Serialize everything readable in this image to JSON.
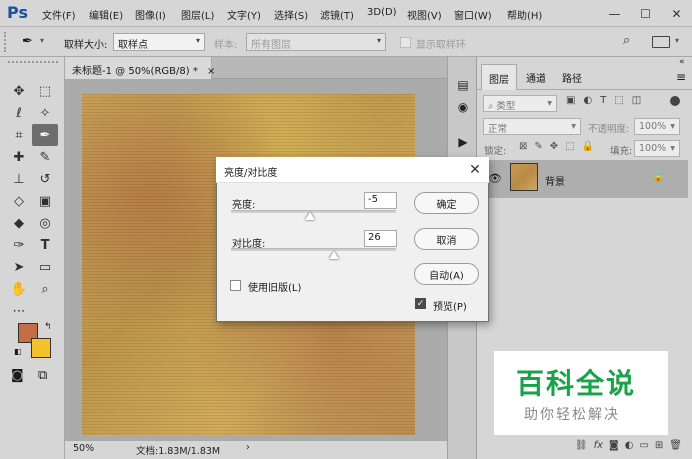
{
  "menubar": {
    "logo": "Ps",
    "items": [
      "文件(F)",
      "编辑(E)",
      "图像(I)",
      "图层(L)",
      "文字(Y)",
      "选择(S)",
      "滤镜(T)",
      "3D(D)",
      "视图(V)",
      "窗口(W)",
      "帮助(H)"
    ],
    "window_controls": [
      "—",
      "☐",
      "✕"
    ]
  },
  "options_bar": {
    "sample_size_label": "取样大小:",
    "sample_size_value": "取样点",
    "sample_label": "样本:",
    "sample_value": "所有图层",
    "show_ring_label": "显示取样环"
  },
  "document": {
    "tab_title": "未标题-1 @ 50%(RGB/8) *",
    "zoom": "50%",
    "doc_info": "文档:1.83M/1.83M"
  },
  "layers_panel": {
    "tabs": [
      "图层",
      "通道",
      "路径"
    ],
    "filter_kind": "类型",
    "blend_mode": "正常",
    "opacity_label": "不透明度:",
    "opacity_value": "100%",
    "lock_label": "锁定:",
    "fill_label": "填充:",
    "fill_value": "100%",
    "layer_name": "背景"
  },
  "dialog": {
    "title": "亮度/对比度",
    "brightness_label": "亮度:",
    "brightness_value": "-5",
    "contrast_label": "对比度:",
    "contrast_value": "26",
    "ok_label": "确定",
    "cancel_label": "取消",
    "auto_label": "自动(A)",
    "legacy_label": "使用旧版(L)",
    "legacy_checked": false,
    "preview_label": "预览(P)",
    "preview_checked": true
  },
  "watermark": {
    "title": "百科全说",
    "subtitle": "助你轻松解决"
  },
  "colors": {
    "foreground": "#c46e48",
    "background": "#f4c22b"
  }
}
